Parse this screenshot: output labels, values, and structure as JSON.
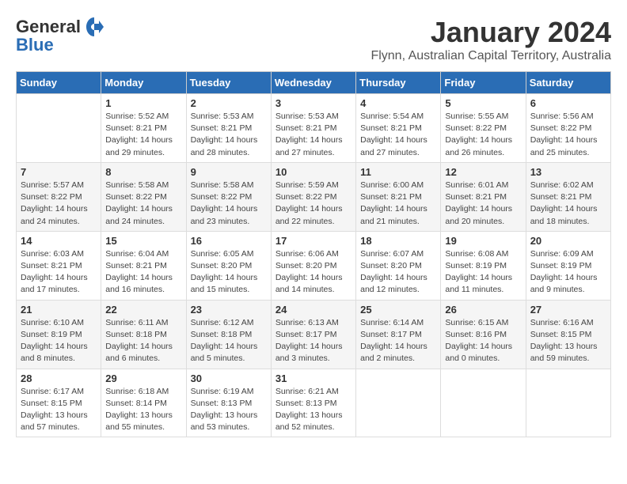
{
  "header": {
    "logo_line1": "General",
    "logo_line2": "Blue",
    "month": "January 2024",
    "location": "Flynn, Australian Capital Territory, Australia"
  },
  "days_of_week": [
    "Sunday",
    "Monday",
    "Tuesday",
    "Wednesday",
    "Thursday",
    "Friday",
    "Saturday"
  ],
  "weeks": [
    [
      {
        "day": "",
        "info": ""
      },
      {
        "day": "1",
        "info": "Sunrise: 5:52 AM\nSunset: 8:21 PM\nDaylight: 14 hours\nand 29 minutes."
      },
      {
        "day": "2",
        "info": "Sunrise: 5:53 AM\nSunset: 8:21 PM\nDaylight: 14 hours\nand 28 minutes."
      },
      {
        "day": "3",
        "info": "Sunrise: 5:53 AM\nSunset: 8:21 PM\nDaylight: 14 hours\nand 27 minutes."
      },
      {
        "day": "4",
        "info": "Sunrise: 5:54 AM\nSunset: 8:21 PM\nDaylight: 14 hours\nand 27 minutes."
      },
      {
        "day": "5",
        "info": "Sunrise: 5:55 AM\nSunset: 8:22 PM\nDaylight: 14 hours\nand 26 minutes."
      },
      {
        "day": "6",
        "info": "Sunrise: 5:56 AM\nSunset: 8:22 PM\nDaylight: 14 hours\nand 25 minutes."
      }
    ],
    [
      {
        "day": "7",
        "info": "Sunrise: 5:57 AM\nSunset: 8:22 PM\nDaylight: 14 hours\nand 24 minutes."
      },
      {
        "day": "8",
        "info": "Sunrise: 5:58 AM\nSunset: 8:22 PM\nDaylight: 14 hours\nand 24 minutes."
      },
      {
        "day": "9",
        "info": "Sunrise: 5:58 AM\nSunset: 8:22 PM\nDaylight: 14 hours\nand 23 minutes."
      },
      {
        "day": "10",
        "info": "Sunrise: 5:59 AM\nSunset: 8:22 PM\nDaylight: 14 hours\nand 22 minutes."
      },
      {
        "day": "11",
        "info": "Sunrise: 6:00 AM\nSunset: 8:21 PM\nDaylight: 14 hours\nand 21 minutes."
      },
      {
        "day": "12",
        "info": "Sunrise: 6:01 AM\nSunset: 8:21 PM\nDaylight: 14 hours\nand 20 minutes."
      },
      {
        "day": "13",
        "info": "Sunrise: 6:02 AM\nSunset: 8:21 PM\nDaylight: 14 hours\nand 18 minutes."
      }
    ],
    [
      {
        "day": "14",
        "info": "Sunrise: 6:03 AM\nSunset: 8:21 PM\nDaylight: 14 hours\nand 17 minutes."
      },
      {
        "day": "15",
        "info": "Sunrise: 6:04 AM\nSunset: 8:21 PM\nDaylight: 14 hours\nand 16 minutes."
      },
      {
        "day": "16",
        "info": "Sunrise: 6:05 AM\nSunset: 8:20 PM\nDaylight: 14 hours\nand 15 minutes."
      },
      {
        "day": "17",
        "info": "Sunrise: 6:06 AM\nSunset: 8:20 PM\nDaylight: 14 hours\nand 14 minutes."
      },
      {
        "day": "18",
        "info": "Sunrise: 6:07 AM\nSunset: 8:20 PM\nDaylight: 14 hours\nand 12 minutes."
      },
      {
        "day": "19",
        "info": "Sunrise: 6:08 AM\nSunset: 8:19 PM\nDaylight: 14 hours\nand 11 minutes."
      },
      {
        "day": "20",
        "info": "Sunrise: 6:09 AM\nSunset: 8:19 PM\nDaylight: 14 hours\nand 9 minutes."
      }
    ],
    [
      {
        "day": "21",
        "info": "Sunrise: 6:10 AM\nSunset: 8:19 PM\nDaylight: 14 hours\nand 8 minutes."
      },
      {
        "day": "22",
        "info": "Sunrise: 6:11 AM\nSunset: 8:18 PM\nDaylight: 14 hours\nand 6 minutes."
      },
      {
        "day": "23",
        "info": "Sunrise: 6:12 AM\nSunset: 8:18 PM\nDaylight: 14 hours\nand 5 minutes."
      },
      {
        "day": "24",
        "info": "Sunrise: 6:13 AM\nSunset: 8:17 PM\nDaylight: 14 hours\nand 3 minutes."
      },
      {
        "day": "25",
        "info": "Sunrise: 6:14 AM\nSunset: 8:17 PM\nDaylight: 14 hours\nand 2 minutes."
      },
      {
        "day": "26",
        "info": "Sunrise: 6:15 AM\nSunset: 8:16 PM\nDaylight: 14 hours\nand 0 minutes."
      },
      {
        "day": "27",
        "info": "Sunrise: 6:16 AM\nSunset: 8:15 PM\nDaylight: 13 hours\nand 59 minutes."
      }
    ],
    [
      {
        "day": "28",
        "info": "Sunrise: 6:17 AM\nSunset: 8:15 PM\nDaylight: 13 hours\nand 57 minutes."
      },
      {
        "day": "29",
        "info": "Sunrise: 6:18 AM\nSunset: 8:14 PM\nDaylight: 13 hours\nand 55 minutes."
      },
      {
        "day": "30",
        "info": "Sunrise: 6:19 AM\nSunset: 8:13 PM\nDaylight: 13 hours\nand 53 minutes."
      },
      {
        "day": "31",
        "info": "Sunrise: 6:21 AM\nSunset: 8:13 PM\nDaylight: 13 hours\nand 52 minutes."
      },
      {
        "day": "",
        "info": ""
      },
      {
        "day": "",
        "info": ""
      },
      {
        "day": "",
        "info": ""
      }
    ]
  ]
}
